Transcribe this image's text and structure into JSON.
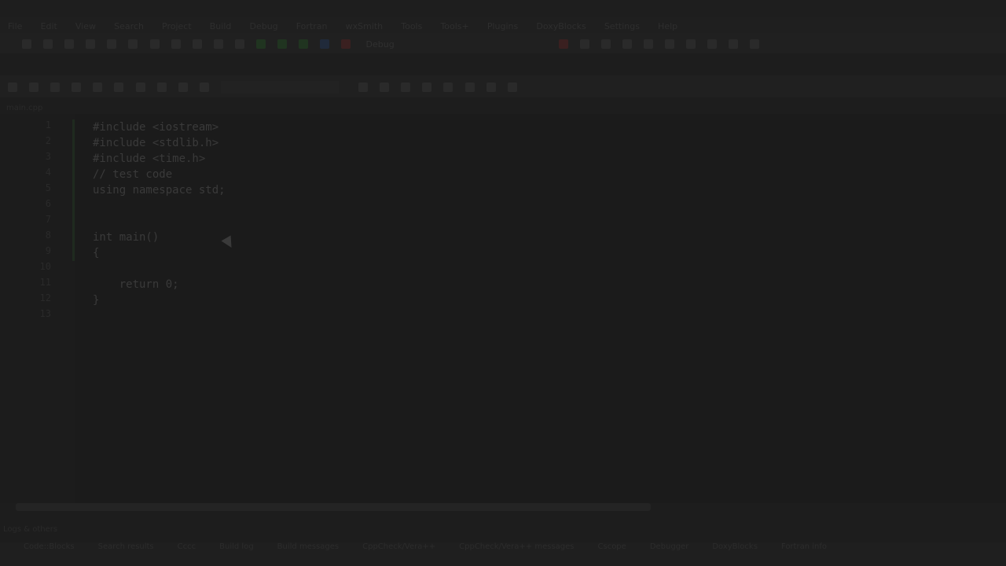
{
  "menu": {
    "items": [
      "File",
      "Edit",
      "View",
      "Search",
      "Project",
      "Build",
      "Debug",
      "Fortran",
      "wxSmith",
      "Tools",
      "Tools+",
      "Plugins",
      "DoxyBlocks",
      "Settings",
      "Help"
    ]
  },
  "toolbar": {
    "build_target_label": "Debug"
  },
  "editor": {
    "file_tab_label": "main.cpp",
    "lines": [
      {
        "num": "1",
        "text": "#include <iostream>"
      },
      {
        "num": "2",
        "text": "#include <stdlib.h>"
      },
      {
        "num": "3",
        "text": "#include <time.h>"
      },
      {
        "num": "4",
        "text": "// test code"
      },
      {
        "num": "5",
        "text": "using namespace std;"
      },
      {
        "num": "6",
        "text": ""
      },
      {
        "num": "7",
        "text": ""
      },
      {
        "num": "8",
        "text": "int main()"
      },
      {
        "num": "9",
        "text": "{"
      },
      {
        "num": "10",
        "text": ""
      },
      {
        "num": "11",
        "text": "    return 0;"
      },
      {
        "num": "12",
        "text": "}"
      },
      {
        "num": "13",
        "text": ""
      }
    ]
  },
  "bottom_panel": {
    "title": "Logs & others",
    "tabs": [
      "Code::Blocks",
      "Search results",
      "Cccc",
      "Build log",
      "Build messages",
      "CppCheck/Vera++",
      "CppCheck/Vera++ messages",
      "Cscope",
      "Debugger",
      "DoxyBlocks",
      "Fortran info"
    ]
  },
  "colors": {
    "background": "#1d1d1d",
    "gutter_marker": "#1f2a1f"
  }
}
